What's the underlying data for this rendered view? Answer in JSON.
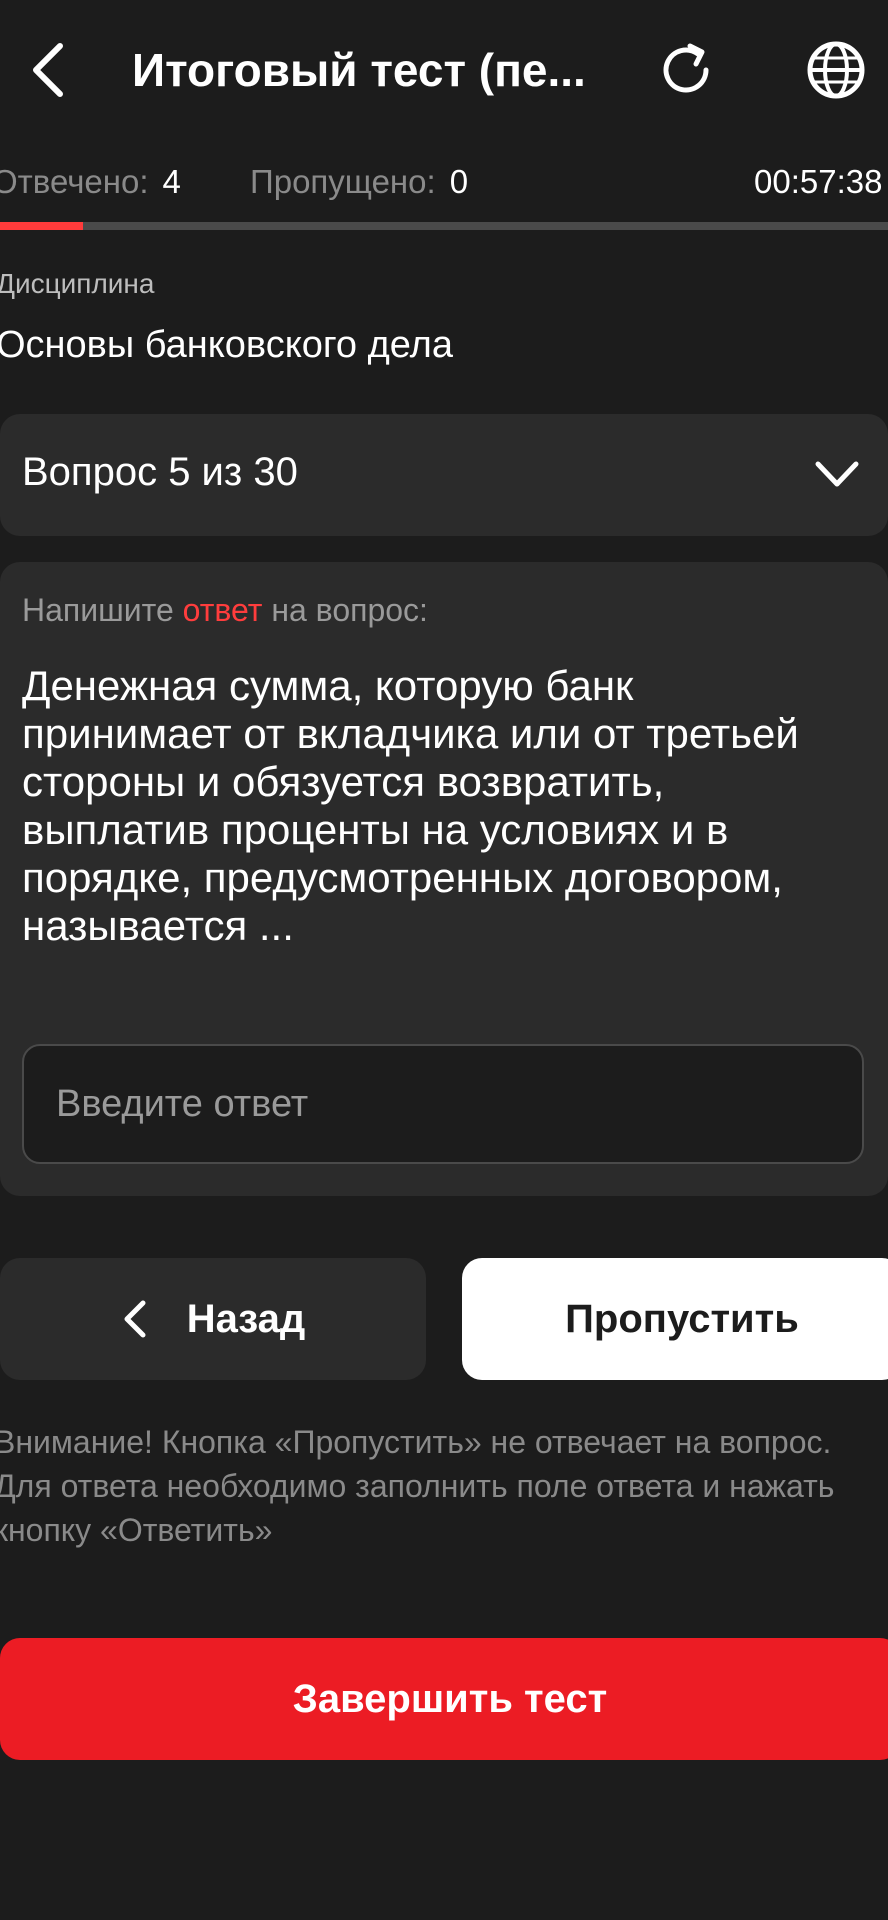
{
  "header": {
    "title": "Итоговый тест (пе...",
    "back_icon": "chevron-left-icon",
    "refresh_icon": "refresh-icon",
    "language_icon": "globe-icon"
  },
  "stats": {
    "answered_label": "Отвечено:",
    "answered_value": "4",
    "skipped_label": "Пропущено:",
    "skipped_value": "0",
    "timer": "00:57:38"
  },
  "progress": {
    "fraction": 0.093
  },
  "discipline": {
    "label": "Дисциплина",
    "value": "Основы банковского дела"
  },
  "question_selector": {
    "label": "Вопрос 5 из 30",
    "icon": "chevron-down-icon"
  },
  "question": {
    "prompt_before": "Напишите ",
    "prompt_accent": "ответ",
    "prompt_after": " на вопрос:",
    "text": "Денежная сумма, которую банк принимает от вкладчика или от третьей стороны и обязуется возвратить, выплатив проценты на условиях и в порядке, предусмотренных договором, называется ...",
    "answer_value": "",
    "answer_placeholder": "Введите ответ"
  },
  "buttons": {
    "back_label": "Назад",
    "skip_label": "Пропустить",
    "finish_label": "Завершить тест"
  },
  "notice": {
    "text": "Внимание! Кнопка «Пропустить» не отвечает на вопрос. Для ответа необходимо заполнить поле ответа и нажать кнопку «Ответить»"
  },
  "colors": {
    "background": "#1c1c1c",
    "card": "#2b2b2b",
    "accent_red": "#ec1c24",
    "progress_red": "#ff3b3b",
    "muted_text": "#8a8a8a"
  }
}
